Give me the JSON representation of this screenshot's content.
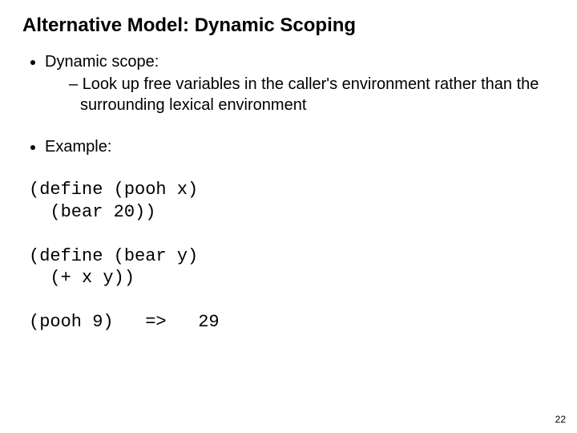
{
  "title": "Alternative Model: Dynamic Scoping",
  "bullet1": "Dynamic scope:",
  "subbullet": "Look up free variables in the caller's environment rather than the surrounding lexical environment",
  "bullet2": "Example:",
  "code": "(define (pooh x)\n  (bear 20))\n\n(define (bear y)\n  (+ x y))\n\n(pooh 9)   =>   29",
  "page_number": "22"
}
